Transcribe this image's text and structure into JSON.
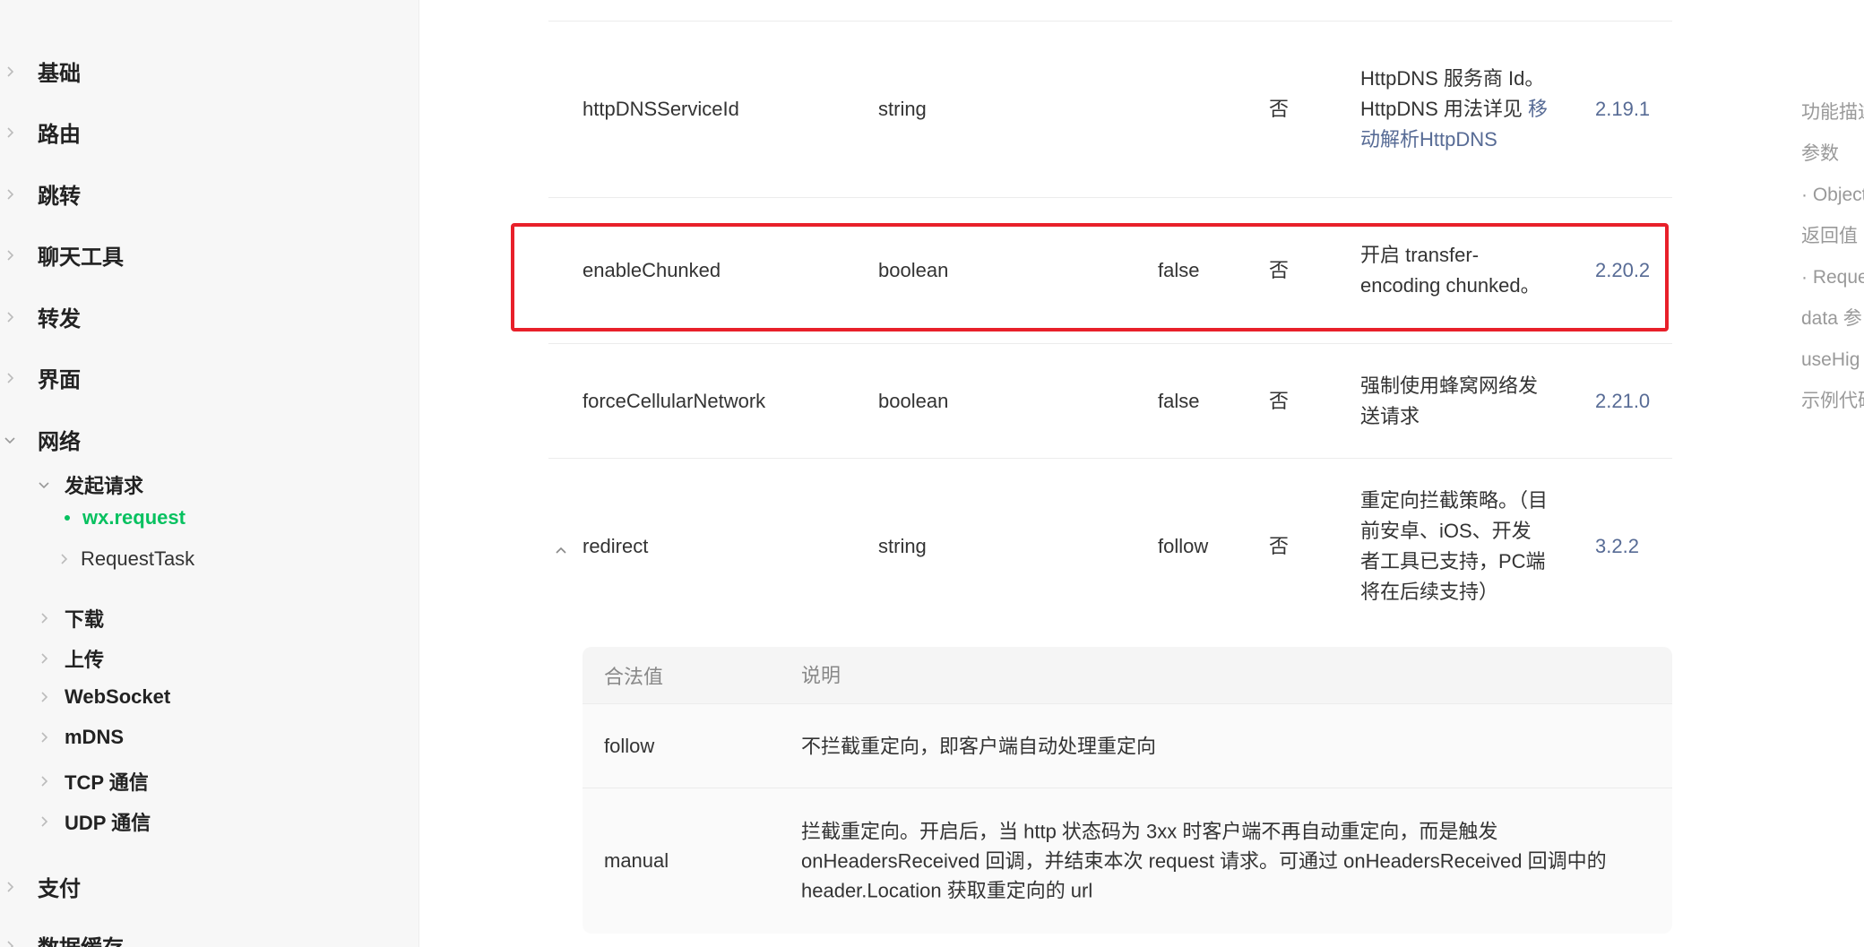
{
  "sidebar": {
    "top_items": [
      "基础",
      "路由",
      "跳转",
      "聊天工具",
      "转发",
      "界面",
      "网络"
    ],
    "network_sub": "发起请求",
    "active": "wx.request",
    "request_task": "RequestTask",
    "sub_items": [
      "下载",
      "上传",
      "WebSocket",
      "mDNS",
      "TCP 通信",
      "UDP 通信"
    ],
    "bottom_items": [
      "支付",
      "数据缓存"
    ]
  },
  "table": {
    "rows": [
      {
        "name": "httpDNSServiceId",
        "type": "string",
        "default": "",
        "required": "否",
        "desc_pre": "HttpDNS 服务商 Id。 HttpDNS 用法详见 ",
        "desc_link": "移动解析HttpDNS",
        "version": "2.19.1"
      },
      {
        "name": "enableChunked",
        "type": "boolean",
        "default": "false",
        "required": "否",
        "desc": "开启 transfer-encoding chunked。",
        "version": "2.20.2"
      },
      {
        "name": "forceCellularNetwork",
        "type": "boolean",
        "default": "false",
        "required": "否",
        "desc": "强制使用蜂窝网络发送请求",
        "version": "2.21.0"
      },
      {
        "name": "redirect",
        "type": "string",
        "default": "follow",
        "required": "否",
        "desc": "重定向拦截策略。（目前安卓、iOS、开发者工具已支持，PC端将在后续支持）",
        "version": "3.2.2"
      }
    ]
  },
  "subtable": {
    "head": [
      "合法值",
      "说明"
    ],
    "rows": [
      {
        "value": "follow",
        "desc": "不拦截重定向，即客户端自动处理重定向"
      },
      {
        "value": "manual",
        "desc": "拦截重定向。开启后，当 http 状态码为 3xx 时客户端不再自动重定向，而是触发 onHeadersReceived 回调，并结束本次 request 请求。可通过 onHeadersReceived 回调中的 header.Location 获取重定向的 url"
      }
    ]
  },
  "toc": [
    "功能描述",
    "参数",
    "· Object",
    "返回值",
    "· Reque",
    "data 参",
    "useHig",
    "示例代码"
  ],
  "colors": {
    "accent": "#07c160",
    "link": "#576b95",
    "highlight": "#e8202a"
  }
}
